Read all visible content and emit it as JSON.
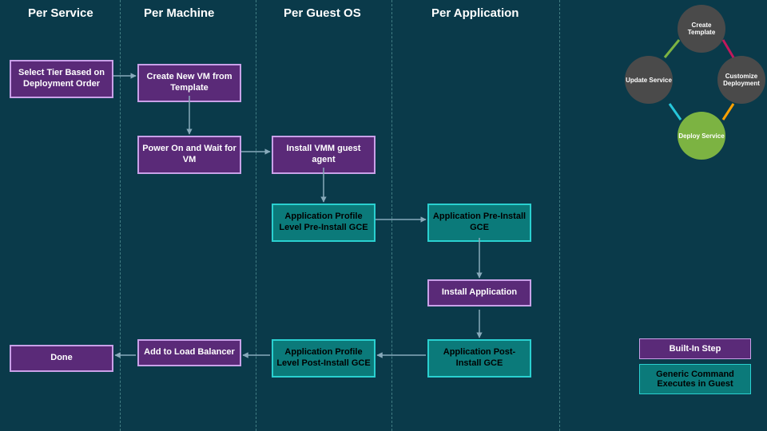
{
  "columns": {
    "service": "Per Service",
    "machine": "Per Machine",
    "guest": "Per Guest OS",
    "app": "Per Application"
  },
  "boxes": {
    "select_tier": "Select Tier Based on Deployment Order",
    "create_vm": "Create New VM from Template",
    "power_on": "Power On and Wait for VM",
    "install_agent": "Install VMM guest agent",
    "profile_pre": "Application Profile Level Pre-Install GCE",
    "app_pre": "Application Pre-Install GCE",
    "install_app": "Install Application",
    "app_post": "Application Post-Install GCE",
    "profile_post": "Application Profile Level Post-Install GCE",
    "add_lb": "Add to Load Balancer",
    "done": "Done"
  },
  "circles": {
    "create_template": "Create Template",
    "update_service": "Update Service",
    "customize_deploy": "Customize Deployment",
    "deploy_service": "Deploy Service"
  },
  "legend": {
    "builtin": "Built-In Step",
    "gce": "Generic Command Executes in Guest"
  }
}
